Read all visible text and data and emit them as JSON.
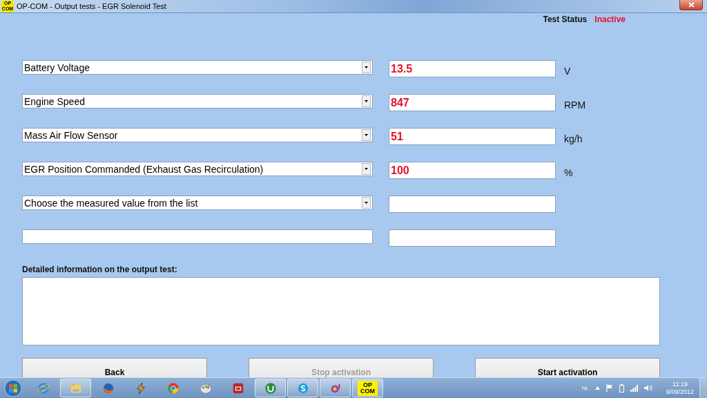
{
  "window": {
    "title": "OP-COM - Output tests - EGR Solenoid Test",
    "app_icon": "OP\nCOM"
  },
  "test_status": {
    "label": "Test Status",
    "value": "Inactive"
  },
  "rows": [
    {
      "kind": "combo",
      "parameter": "Battery Voltage",
      "value": "13.5",
      "unit": "V"
    },
    {
      "kind": "combo",
      "parameter": "Engine Speed",
      "value": "847",
      "unit": "RPM"
    },
    {
      "kind": "combo",
      "parameter": "Mass Air Flow Sensor",
      "value": "51",
      "unit": "kg/h"
    },
    {
      "kind": "combo",
      "parameter": "EGR Position Commanded (Exhaust Gas Recirculation)",
      "value": "100",
      "unit": "%"
    },
    {
      "kind": "combo",
      "parameter": "Choose the measured value from the list"
    },
    {
      "kind": "field"
    }
  ],
  "details": {
    "label": "Detailed information on the output test:"
  },
  "buttons": [
    {
      "label": "Back",
      "disabled": false
    },
    {
      "label": "Stop activation",
      "disabled": true
    },
    {
      "label": "Start activation",
      "disabled": false
    }
  ],
  "taskbar": {
    "apps": [
      {
        "kind": "ie",
        "running": false
      },
      {
        "kind": "folder",
        "running": true
      },
      {
        "kind": "firefox",
        "running": false
      },
      {
        "kind": "bolt",
        "running": false
      },
      {
        "kind": "chrome",
        "running": false
      },
      {
        "kind": "palette",
        "running": false
      },
      {
        "kind": "redapp",
        "running": false
      },
      {
        "kind": "torrent",
        "running": true
      },
      {
        "kind": "skype",
        "running": true
      },
      {
        "kind": "messenger",
        "running": true
      },
      {
        "kind": "opcom",
        "running": true,
        "label": "OP\nCOM"
      }
    ],
    "language": "NL",
    "time": "11:19",
    "date": "9/09/2012"
  }
}
